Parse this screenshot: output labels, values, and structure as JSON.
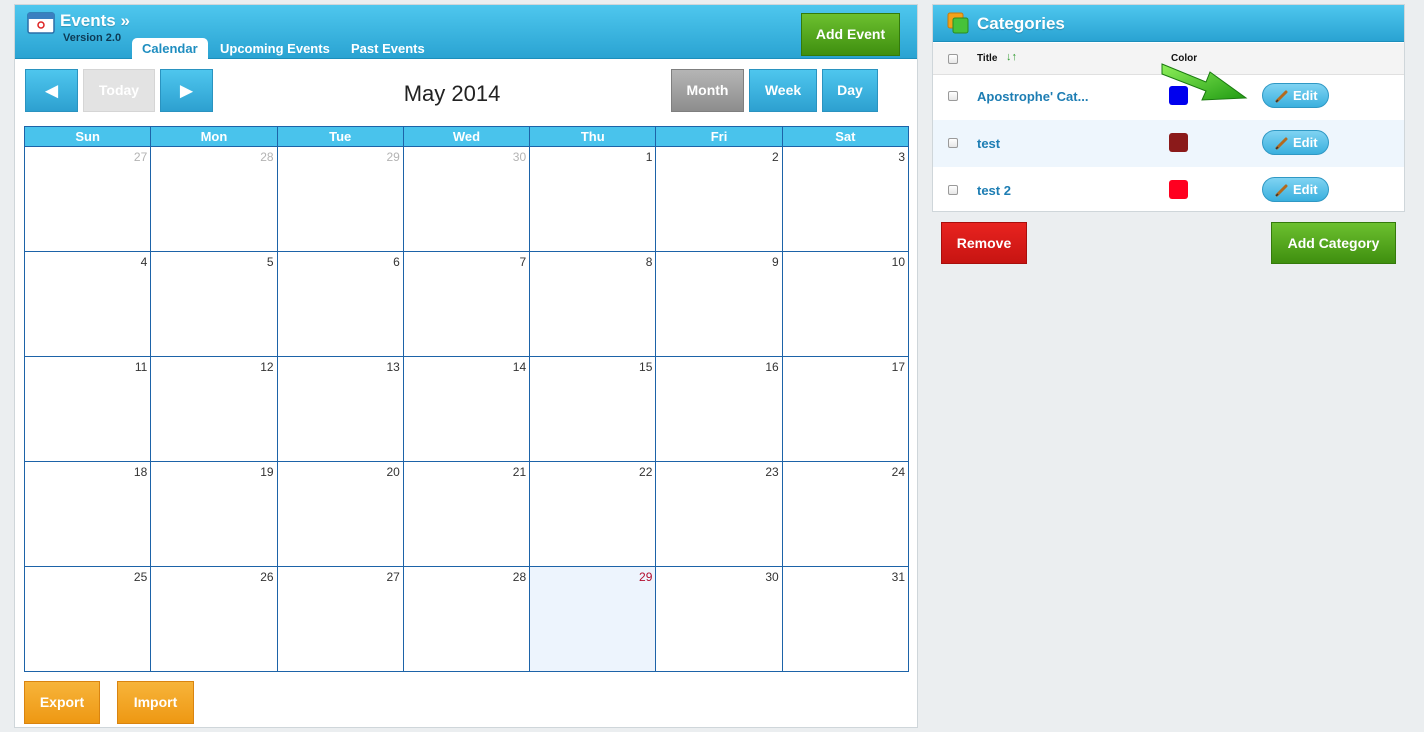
{
  "app": {
    "title": "Events »",
    "version": "Version 2.0",
    "add_event": "Add Event"
  },
  "tabs": [
    {
      "label": "Calendar",
      "active": true
    },
    {
      "label": "Upcoming Events",
      "active": false
    },
    {
      "label": "Past Events",
      "active": false
    }
  ],
  "nav": {
    "prev": "◄",
    "today": "Today",
    "next": "►"
  },
  "views": {
    "month": "Month",
    "week": "Week",
    "day": "Day",
    "selected": "Month"
  },
  "calendar": {
    "title": "May 2014",
    "weekdays": [
      "Sun",
      "Mon",
      "Tue",
      "Wed",
      "Thu",
      "Fri",
      "Sat"
    ],
    "weeks": [
      [
        "27",
        "28",
        "29",
        "30",
        "1",
        "2",
        "3"
      ],
      [
        "4",
        "5",
        "6",
        "7",
        "8",
        "9",
        "10"
      ],
      [
        "11",
        "12",
        "13",
        "14",
        "15",
        "16",
        "17"
      ],
      [
        "18",
        "19",
        "20",
        "21",
        "22",
        "23",
        "24"
      ],
      [
        "25",
        "26",
        "27",
        "28",
        "29",
        "30",
        "31"
      ]
    ],
    "today": "29"
  },
  "footer": {
    "export": "Export",
    "import": "Import"
  },
  "categories": {
    "title": "Categories",
    "col_title": "Title",
    "col_color": "Color",
    "sort_icon": "↓↑",
    "rows": [
      {
        "name": "Apostrophe' Cat...",
        "color": "#0000ee",
        "edit": "Edit"
      },
      {
        "name": "test",
        "color": "#8b1a1a",
        "edit": "Edit"
      },
      {
        "name": "test 2",
        "color": "#ff0020",
        "edit": "Edit"
      }
    ],
    "remove": "Remove",
    "add": "Add Category"
  },
  "colors": {
    "header_blue": "#2aa3d2",
    "green": "#3f8f0f",
    "orange": "#ee9813",
    "red": "#c71412",
    "today_text": "#b30d2e"
  }
}
